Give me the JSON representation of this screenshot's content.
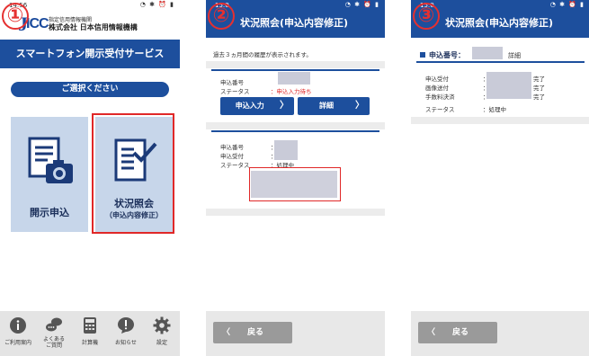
{
  "screens": [
    {
      "step": "①",
      "status": {
        "time": "14:56",
        "icons": "◔ ✱ ⏰ ▮"
      },
      "org_line1": "指定信用情報機関",
      "org_line2": "株式会社 日本信用情報機構",
      "logo_j": "J",
      "logo_cc": "ICC",
      "service_title": "スマートフォン開示受付サービス",
      "select_prompt": "ご選択ください",
      "tile_disclosure": "開示申込",
      "tile_status": "状況照会",
      "tile_status_sub": "（申込内容修正）",
      "nav": [
        {
          "label": "ご利用案内",
          "icon": "info-icon"
        },
        {
          "label": "よくある\nご質問",
          "icon": "chat-icon"
        },
        {
          "label": "計算機",
          "icon": "calculator-icon"
        },
        {
          "label": "お知らせ",
          "icon": "notice-icon"
        },
        {
          "label": "設定",
          "icon": "gear-icon"
        }
      ]
    },
    {
      "step": "②",
      "status": {
        "time": "15:0",
        "icons": "◔ ✱ ⏰ ▮"
      },
      "title": "状況照会(申込内容修正)",
      "note": "過去３ヵ月間の履歴が表示されます。",
      "card1": {
        "label_no": "申込番号",
        "label_status": "ステータス",
        "status_value": "：申込入力待ち",
        "btn_input": "申込入力",
        "btn_detail": "詳細"
      },
      "card2": {
        "label_no": "申込番号",
        "label_accept": "申込受付",
        "label_status": "ステータス",
        "colon": "：",
        "status_value": "：処理中"
      },
      "back": "戻る"
    },
    {
      "step": "③",
      "status": {
        "time": "15:0",
        "icons": "◔ ✱ ⏰ ▮"
      },
      "title": "状況照会(申込内容修正)",
      "app_no_label": "申込番号：",
      "detail_label": "詳細",
      "rows": [
        {
          "label": "申込受付",
          "colon": "：",
          "value": "完了"
        },
        {
          "label": "画像送付",
          "colon": "：",
          "value": "完了"
        },
        {
          "label": "手数料決済",
          "colon": "：",
          "value": "完了"
        }
      ],
      "status_label": "ステータス",
      "status_value": "：処理中",
      "back": "戻る"
    }
  ],
  "colors": {
    "brand_blue": "#1d4f9d",
    "highlight_red": "#e02828",
    "tile_bg": "#c7d6ea"
  }
}
